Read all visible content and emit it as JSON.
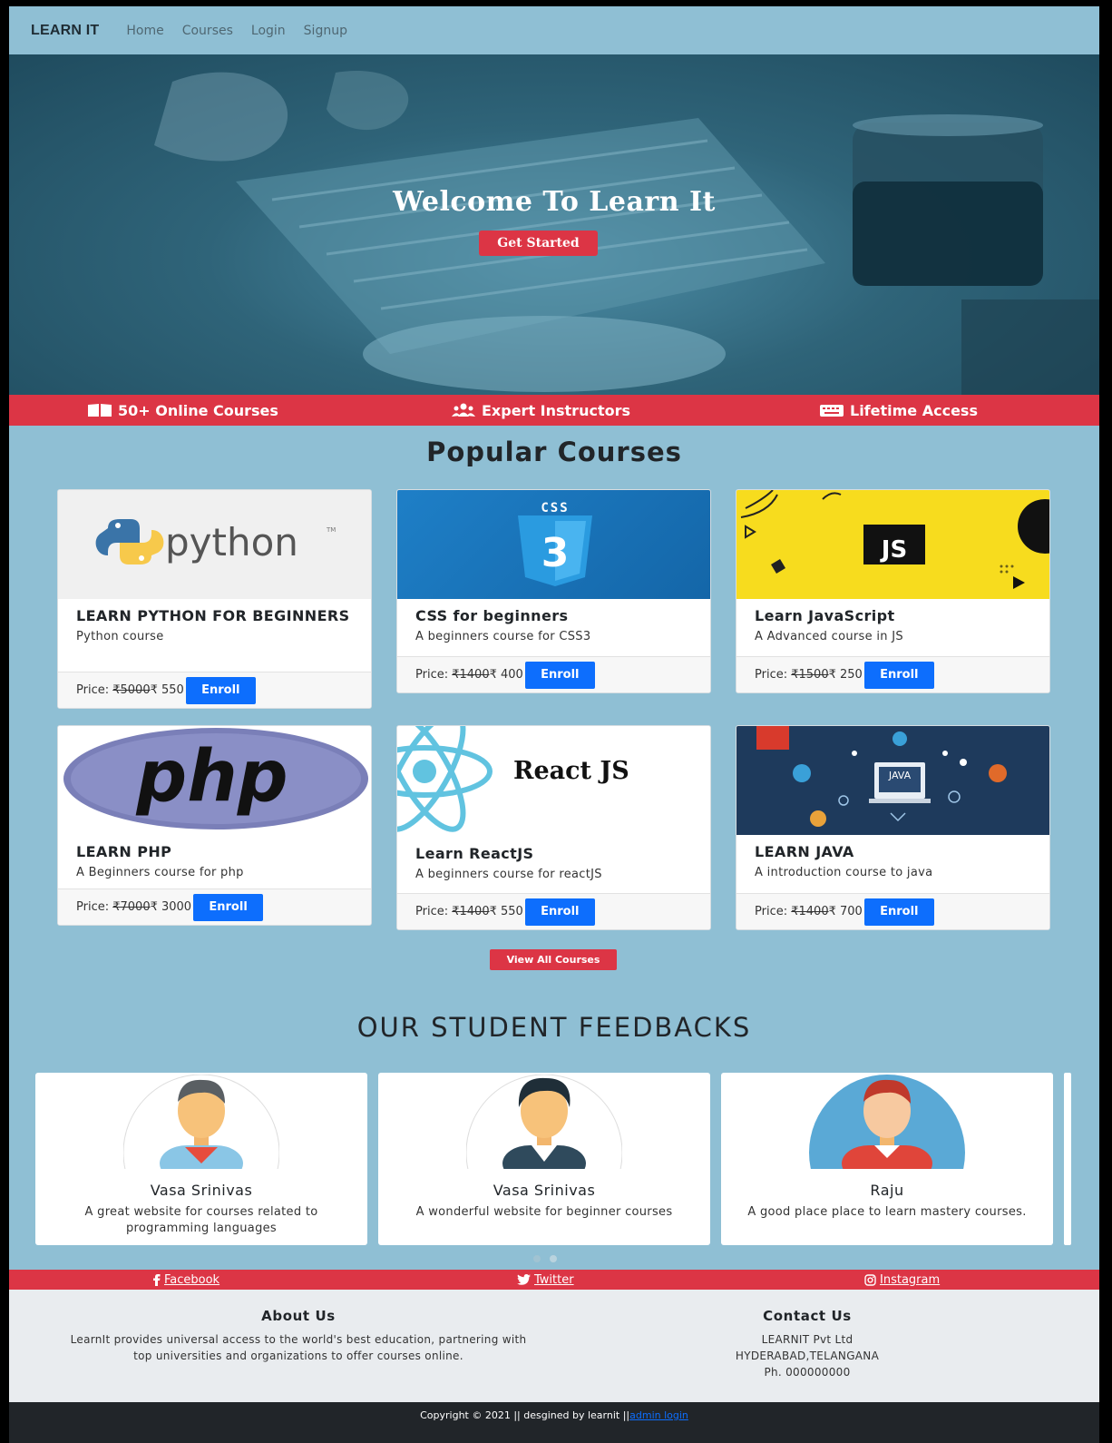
{
  "nav": {
    "brand": "LEARN IT",
    "links": [
      "Home",
      "Courses",
      "Login",
      "Signup"
    ]
  },
  "hero": {
    "title": "Welcome To Learn It",
    "button": "Get Started"
  },
  "features": [
    {
      "label": "50+ Online Courses",
      "icon": "book-icon"
    },
    {
      "label": "Expert Instructors",
      "icon": "users-icon"
    },
    {
      "label": "Lifetime Access",
      "icon": "keyboard-icon"
    }
  ],
  "popular": {
    "title": "Popular Courses",
    "price_label": "Price:",
    "enroll": "Enroll",
    "courses": [
      {
        "logo": "python",
        "title": "LEARN PYTHON FOR BEGINNERS",
        "desc": "Python course",
        "old_price": "₹5000",
        "new_price": "₹ 550"
      },
      {
        "logo": "CSS",
        "title": "CSS for beginners",
        "desc": "A beginners course for CSS3",
        "old_price": "₹1400",
        "new_price": "₹ 400"
      },
      {
        "logo": "JS",
        "title": "Learn JavaScript",
        "desc": "A Advanced course in JS",
        "old_price": "₹1500",
        "new_price": "₹ 250"
      },
      {
        "logo": "php",
        "title": "LEARN PHP",
        "desc": "A Beginners course for php",
        "old_price": "₹7000",
        "new_price": "₹ 3000"
      },
      {
        "logo": "React JS",
        "title": "Learn ReactJS",
        "desc": "A beginners course for reactJS",
        "old_price": "₹1400",
        "new_price": "₹ 550"
      },
      {
        "logo": "JAVA",
        "title": "LEARN JAVA",
        "desc": "A introduction course to java",
        "old_price": "₹1400",
        "new_price": "₹ 700"
      }
    ],
    "view_all": "View All Courses"
  },
  "feedbacks": {
    "title": "OUR STUDENT FEEDBACKS",
    "items": [
      {
        "name": "Vasa Srinivas",
        "text": "A great website for courses related to programming languages"
      },
      {
        "name": "Vasa Srinivas",
        "text": "A wonderful website for beginner courses"
      },
      {
        "name": "Raju",
        "text": "A good place place to learn mastery courses."
      }
    ]
  },
  "social": [
    {
      "label": "Facebook",
      "icon": "facebook-icon"
    },
    {
      "label": "Twitter",
      "icon": "twitter-icon"
    },
    {
      "label": "Instagram",
      "icon": "instagram-icon"
    }
  ],
  "footer": {
    "about_title": "About Us",
    "about_text": "LearnIt provides universal access to the world's best education, partnering with top universities and organizations to offer courses online.",
    "contact_title": "Contact Us",
    "contact_lines": [
      "LEARNIT Pvt Ltd",
      "HYDERABAD,TELANGANA",
      "Ph. 000000000"
    ],
    "copyright": "Copyright © 2021 || desgined by learnit ||",
    "admin_link": "admin login"
  },
  "colors": {
    "page_bg": "#8fbfd4",
    "accent_red": "#dc3545",
    "button_blue": "#0d6efd",
    "footer_bg": "#e9ecef",
    "copyright_bg": "#212529"
  }
}
